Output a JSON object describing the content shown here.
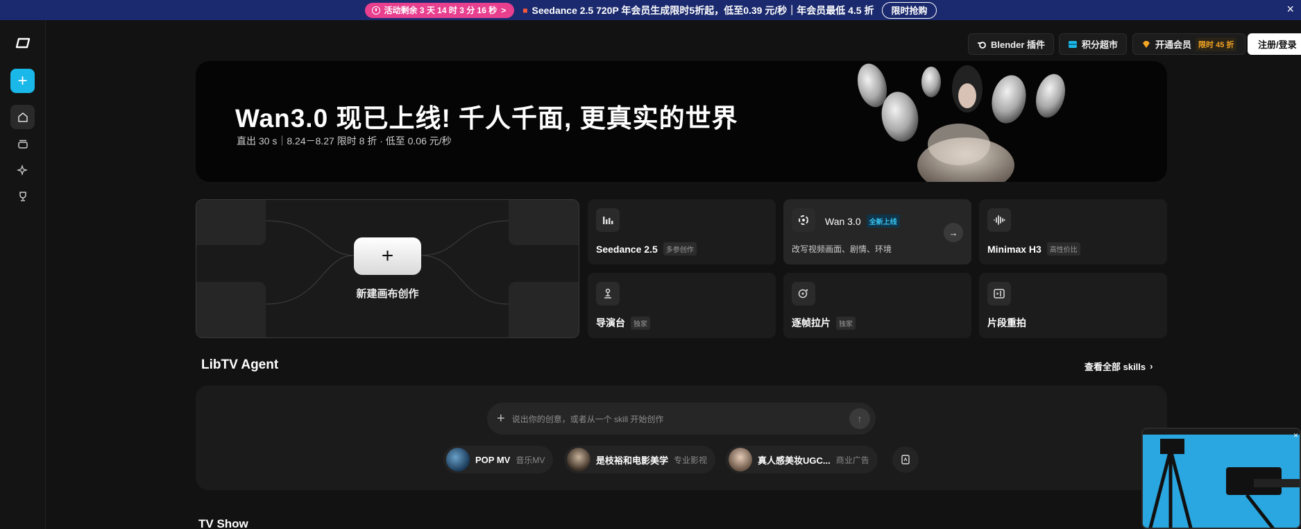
{
  "promo": {
    "timer_label": "活动剩余 3 天 14 时 3 分 16 秒",
    "timer_arrow": ">",
    "text": "Seedance 2.5 720P 年会员生成限时5折起，低至0.39 元/秒｜年会员最低 4.5 折",
    "cta": "限时抢购",
    "close": "×"
  },
  "sidebar": {
    "add_label": "+",
    "items": [
      {
        "name": "home",
        "active": true
      },
      {
        "name": "library",
        "active": false
      },
      {
        "name": "sparkle",
        "active": false
      },
      {
        "name": "trophy",
        "active": false
      }
    ]
  },
  "topbar": {
    "blender": "Blender 插件",
    "points": "积分超市",
    "vip": "开通会员",
    "vip_badge": "限时 45 折",
    "login": "注册/登录"
  },
  "banner": {
    "title": "Wan3.0 现已上线! 千人千面, 更真实的世界",
    "subtitle": "直出 30 s｜8.24－8.27  限时 8 折 · 低至 0.06 元/秒"
  },
  "canvas": {
    "plus": "+",
    "label": "新建画布创作"
  },
  "cards": {
    "seedance": {
      "title": "Seedance 2.5",
      "tag": "多参创作"
    },
    "wan": {
      "title": "Wan 3.0",
      "tag": "全新上线",
      "desc": "改写视频画面、剧情、环境",
      "arrow": "→"
    },
    "minimax": {
      "title": "Minimax H3",
      "tag": "高性价比"
    },
    "director": {
      "title": "导演台",
      "tag": "独家"
    },
    "frames": {
      "title": "逐帧拉片",
      "tag": "独家"
    },
    "reshoot": {
      "title": "片段重拍"
    }
  },
  "agent": {
    "title": "LibTV Agent",
    "link": "查看全部 skills",
    "link_arrow": "›",
    "input_plus": "+",
    "placeholder": "说出你的创意，或者从一个 skill 开始创作",
    "send": "↑",
    "chips": [
      {
        "label": "POP MV",
        "category": "音乐MV"
      },
      {
        "label": "是枝裕和电影美学",
        "category": "专业影视"
      },
      {
        "label": "真人感美妆UGC...",
        "category": "商业广告"
      }
    ]
  },
  "sections": {
    "tv": "TV Show"
  },
  "float_video": {
    "close": "×"
  },
  "colors": {
    "accent": "#1ab8e8",
    "promo_bg": "#1b2a6e",
    "promo_pink": "#e83f8f",
    "vip_gold": "#f5a623"
  }
}
